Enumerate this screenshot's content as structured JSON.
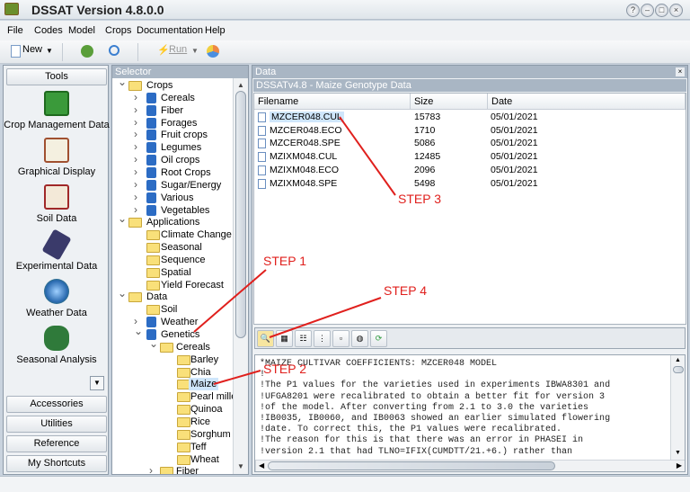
{
  "window": {
    "title": "DSSAT Version 4.8.0.0"
  },
  "menu": [
    "File",
    "Codes",
    "Model",
    "Crops",
    "Documentation",
    "Help"
  ],
  "toolbar": {
    "new_label": "New",
    "run_label": "Run"
  },
  "tools": {
    "header": "Tools",
    "items": [
      "Crop Management Data",
      "Graphical Display",
      "Soil Data",
      "Experimental Data",
      "Weather Data",
      "Seasonal Analysis"
    ],
    "buttons": [
      "Accessories",
      "Utilities",
      "Reference",
      "My Shortcuts"
    ]
  },
  "selector": {
    "header": "Selector",
    "tree": [
      {
        "label": "Crops",
        "level": 0,
        "icon": "folder",
        "exp": "v"
      },
      {
        "label": "Cereals",
        "level": 1,
        "icon": "db",
        "exp": ">"
      },
      {
        "label": "Fiber",
        "level": 1,
        "icon": "db",
        "exp": ">"
      },
      {
        "label": "Forages",
        "level": 1,
        "icon": "db",
        "exp": ">"
      },
      {
        "label": "Fruit crops",
        "level": 1,
        "icon": "db",
        "exp": ">"
      },
      {
        "label": "Legumes",
        "level": 1,
        "icon": "db",
        "exp": ">"
      },
      {
        "label": "Oil crops",
        "level": 1,
        "icon": "db",
        "exp": ">"
      },
      {
        "label": "Root Crops",
        "level": 1,
        "icon": "db",
        "exp": ">"
      },
      {
        "label": "Sugar/Energy",
        "level": 1,
        "icon": "db",
        "exp": ">"
      },
      {
        "label": "Various",
        "level": 1,
        "icon": "db",
        "exp": ">"
      },
      {
        "label": "Vegetables",
        "level": 1,
        "icon": "db",
        "exp": ">"
      },
      {
        "label": "Applications",
        "level": 0,
        "icon": "folder",
        "exp": "v"
      },
      {
        "label": "Climate Change",
        "level": 1,
        "icon": "folder",
        "exp": ""
      },
      {
        "label": "Seasonal",
        "level": 1,
        "icon": "folder",
        "exp": ""
      },
      {
        "label": "Sequence",
        "level": 1,
        "icon": "folder",
        "exp": ""
      },
      {
        "label": "Spatial",
        "level": 1,
        "icon": "folder",
        "exp": ""
      },
      {
        "label": "Yield Forecast",
        "level": 1,
        "icon": "folder",
        "exp": ""
      },
      {
        "label": "Data",
        "level": 0,
        "icon": "folder",
        "exp": "v"
      },
      {
        "label": "Soil",
        "level": 1,
        "icon": "folder",
        "exp": ""
      },
      {
        "label": "Weather",
        "level": 1,
        "icon": "db",
        "exp": ">"
      },
      {
        "label": "Genetics",
        "level": 1,
        "icon": "db",
        "exp": "v"
      },
      {
        "label": "Cereals",
        "level": 2,
        "icon": "folder",
        "exp": "v"
      },
      {
        "label": "Barley",
        "level": 3,
        "icon": "folder",
        "exp": ""
      },
      {
        "label": "Chia",
        "level": 3,
        "icon": "folder",
        "exp": ""
      },
      {
        "label": "Maize",
        "level": 3,
        "icon": "folder",
        "exp": "",
        "selected": true
      },
      {
        "label": "Pearl millet",
        "level": 3,
        "icon": "folder",
        "exp": ""
      },
      {
        "label": "Quinoa",
        "level": 3,
        "icon": "folder",
        "exp": ""
      },
      {
        "label": "Rice",
        "level": 3,
        "icon": "folder",
        "exp": ""
      },
      {
        "label": "Sorghum",
        "level": 3,
        "icon": "folder",
        "exp": ""
      },
      {
        "label": "Teff",
        "level": 3,
        "icon": "folder",
        "exp": ""
      },
      {
        "label": "Wheat",
        "level": 3,
        "icon": "folder",
        "exp": ""
      },
      {
        "label": "Fiber",
        "level": 2,
        "icon": "folder",
        "exp": ">"
      }
    ]
  },
  "data": {
    "header": "Data",
    "subtitle": "DSSATv4.8 - Maize Genotype Data",
    "columns": [
      "Filename",
      "Size",
      "Date"
    ],
    "rows": [
      {
        "name": "MZCER048.CUL",
        "size": "15783",
        "date": "05/01/2021"
      },
      {
        "name": "MZCER048.ECO",
        "size": "1710",
        "date": "05/01/2021"
      },
      {
        "name": "MZCER048.SPE",
        "size": "5086",
        "date": "05/01/2021"
      },
      {
        "name": "MZIXM048.CUL",
        "size": "12485",
        "date": "05/01/2021"
      },
      {
        "name": "MZIXM048.ECO",
        "size": "2096",
        "date": "05/01/2021"
      },
      {
        "name": "MZIXM048.SPE",
        "size": "5498",
        "date": "05/01/2021"
      }
    ],
    "text_lines": [
      "*MAIZE CULTIVAR COEFFICIENTS: MZCER048 MODEL",
      "!",
      "!The P1 values for the varieties used in experiments IBWA8301 and",
      "!UFGA8201 were recalibrated to obtain a better fit for version 3",
      "!of the model. After converting from 2.1 to 3.0 the varieties",
      "!IB0035, IB0060, and IB0063 showed an earlier simulated flowering",
      "!date. To correct this, the P1 values were recalibrated.",
      "!The reason for this is that there was an error in PHASEI in",
      "!version 2.1 that had TLNO=IFIX(CUMDTT/21.+6.) rather than"
    ]
  },
  "annotations": [
    "STEP 1",
    "STEP 2",
    "STEP 3",
    "STEP 4"
  ],
  "colors": {
    "annotation": "#e0201d",
    "header": "#a9b6c4"
  }
}
